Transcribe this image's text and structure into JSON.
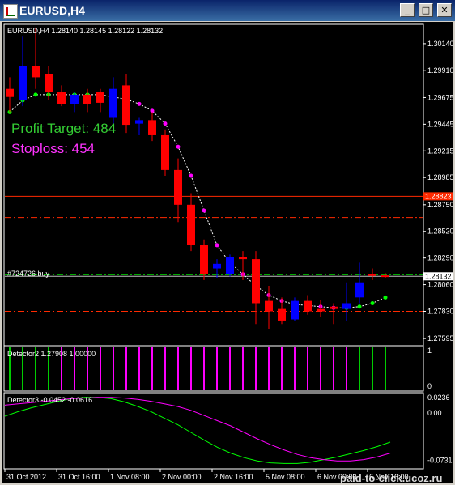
{
  "window": {
    "title": "EURUSD,H4",
    "buttons": {
      "minimize": "_",
      "maximize": "□",
      "close": "✕"
    }
  },
  "chart_data": {
    "type": "candlestick",
    "symbol_line": "EURUSD,H4  1.28140 1.28145 1.28122 1.28132",
    "price_axis": {
      "ylim": [
        1.2754,
        1.303
      ],
      "ticks": [
        "1.30140",
        "1.29910",
        "1.29675",
        "1.29445",
        "1.29215",
        "1.28985",
        "1.28750",
        "1.28520",
        "1.28290",
        "1.28060",
        "1.27830",
        "1.27595"
      ],
      "tick_values": [
        1.3014,
        1.2991,
        1.29675,
        1.29445,
        1.29215,
        1.28985,
        1.2875,
        1.2852,
        1.2829,
        1.2806,
        1.2783,
        1.27595
      ],
      "current_price": "1.28132",
      "marked_price": "1.28823"
    },
    "time_axis": [
      "31 Oct 2012",
      "31 Oct 16:00",
      "1 Nov 08:00",
      "2 Nov 00:00",
      "2 Nov 16:00",
      "5 Nov 08:00",
      "6 Nov 00:00",
      "6 Nov 16:00"
    ],
    "candles": [
      {
        "o": 1.2975,
        "h": 1.2985,
        "l": 1.2955,
        "c": 1.2968,
        "dir": "down"
      },
      {
        "o": 1.2965,
        "h": 1.302,
        "l": 1.296,
        "c": 1.2995,
        "dir": "up"
      },
      {
        "o": 1.2995,
        "h": 1.3028,
        "l": 1.2975,
        "c": 1.2985,
        "dir": "down"
      },
      {
        "o": 1.2988,
        "h": 1.2995,
        "l": 1.2965,
        "c": 1.2972,
        "dir": "down"
      },
      {
        "o": 1.2972,
        "h": 1.2978,
        "l": 1.296,
        "c": 1.2962,
        "dir": "down"
      },
      {
        "o": 1.2962,
        "h": 1.2972,
        "l": 1.2955,
        "c": 1.297,
        "dir": "up"
      },
      {
        "o": 1.297,
        "h": 1.2975,
        "l": 1.2955,
        "c": 1.2962,
        "dir": "down"
      },
      {
        "o": 1.2963,
        "h": 1.2975,
        "l": 1.2955,
        "c": 1.2972,
        "dir": "down"
      },
      {
        "o": 1.295,
        "h": 1.2985,
        "l": 1.294,
        "c": 1.2975,
        "dir": "up"
      },
      {
        "o": 1.2978,
        "h": 1.2988,
        "l": 1.2937,
        "c": 1.2944,
        "dir": "down"
      },
      {
        "o": 1.2945,
        "h": 1.295,
        "l": 1.2935,
        "c": 1.2948,
        "dir": "up"
      },
      {
        "o": 1.2948,
        "h": 1.2955,
        "l": 1.293,
        "c": 1.2935,
        "dir": "down"
      },
      {
        "o": 1.2935,
        "h": 1.294,
        "l": 1.29,
        "c": 1.2905,
        "dir": "down"
      },
      {
        "o": 1.2905,
        "h": 1.2915,
        "l": 1.286,
        "c": 1.2875,
        "dir": "down"
      },
      {
        "o": 1.2875,
        "h": 1.2885,
        "l": 1.2835,
        "c": 1.284,
        "dir": "down"
      },
      {
        "o": 1.284,
        "h": 1.2845,
        "l": 1.281,
        "c": 1.2815,
        "dir": "down"
      },
      {
        "o": 1.282,
        "h": 1.2828,
        "l": 1.2812,
        "c": 1.2824,
        "dir": "up"
      },
      {
        "o": 1.2815,
        "h": 1.2832,
        "l": 1.2813,
        "c": 1.283,
        "dir": "up"
      },
      {
        "o": 1.283,
        "h": 1.2835,
        "l": 1.281,
        "c": 1.2828,
        "dir": "down"
      },
      {
        "o": 1.2828,
        "h": 1.2835,
        "l": 1.2772,
        "c": 1.279,
        "dir": "down"
      },
      {
        "o": 1.2792,
        "h": 1.2805,
        "l": 1.2768,
        "c": 1.2783,
        "dir": "down"
      },
      {
        "o": 1.2785,
        "h": 1.2795,
        "l": 1.2772,
        "c": 1.2775,
        "dir": "down"
      },
      {
        "o": 1.2776,
        "h": 1.2795,
        "l": 1.2775,
        "c": 1.2792,
        "dir": "up"
      },
      {
        "o": 1.2792,
        "h": 1.2797,
        "l": 1.278,
        "c": 1.2783,
        "dir": "down"
      },
      {
        "o": 1.2785,
        "h": 1.2793,
        "l": 1.2778,
        "c": 1.2783,
        "dir": "down"
      },
      {
        "o": 1.2787,
        "h": 1.279,
        "l": 1.2772,
        "c": 1.2785,
        "dir": "down"
      },
      {
        "o": 1.2785,
        "h": 1.2808,
        "l": 1.2775,
        "c": 1.279,
        "dir": "up"
      },
      {
        "o": 1.2795,
        "h": 1.2825,
        "l": 1.279,
        "c": 1.2808,
        "dir": "up"
      },
      {
        "o": 1.2815,
        "h": 1.282,
        "l": 1.281,
        "c": 1.2814,
        "dir": "down"
      },
      {
        "o": 1.2814,
        "h": 1.2816,
        "l": 1.2812,
        "c": 1.2813,
        "dir": "down"
      }
    ],
    "trend_line": [
      1.2955,
      1.2965,
      1.297,
      1.297,
      1.297,
      1.297,
      1.297,
      1.297,
      1.2968,
      1.2966,
      1.2962,
      1.2956,
      1.2945,
      1.2925,
      1.29,
      1.287,
      1.284,
      1.2825,
      1.2815,
      1.2805,
      1.2797,
      1.2792,
      1.2789,
      1.2788,
      1.2787,
      1.2786,
      1.2786,
      1.2787,
      1.279,
      1.2795
    ],
    "horizontal_levels": [
      {
        "price": 1.28823,
        "style": "solid",
        "color": "#ff2a00"
      },
      {
        "price": 1.2864,
        "style": "dashdot",
        "color": "#ff2a00"
      },
      {
        "price": 1.28145,
        "style": "dashdot",
        "color": "#00c000"
      },
      {
        "price": 1.28132,
        "style": "solid",
        "color": "#c0c0c0"
      },
      {
        "price": 1.2783,
        "style": "dashdot",
        "color": "#ff2a00"
      }
    ],
    "order_label": "#724726 buy",
    "profit_target": "Profit Target: 484",
    "stoploss": "Stoploss: 454",
    "detector2": {
      "label": "Detector2  1.27908 1.00000",
      "ticks": [
        "1",
        "0"
      ],
      "bars": [
        "green",
        "green",
        "green",
        "green",
        "magenta",
        "magenta",
        "magenta",
        "magenta",
        "magenta",
        "magenta",
        "magenta",
        "magenta",
        "magenta",
        "magenta",
        "magenta",
        "magenta",
        "magenta",
        "magenta",
        "magenta",
        "magenta",
        "magenta",
        "magenta",
        "magenta",
        "magenta",
        "magenta",
        "magenta",
        "magenta",
        "green",
        "green",
        "green"
      ]
    },
    "detector3": {
      "label": "Detector3  -0.0452 -0.0616",
      "ylim": [
        -0.085,
        0.03
      ],
      "ticks": [
        "0.0236",
        "0.00",
        "-0.0731"
      ],
      "tick_values": [
        0.0236,
        0.0,
        -0.0731
      ],
      "series": [
        {
          "color": "#00ff00",
          "values": [
            -0.005,
            0.002,
            0.008,
            0.013,
            0.018,
            0.022,
            0.024,
            0.024,
            0.022,
            0.017,
            0.01,
            0.002,
            -0.008,
            -0.018,
            -0.03,
            -0.042,
            -0.053,
            -0.062,
            -0.069,
            -0.074,
            -0.077,
            -0.078,
            -0.078,
            -0.076,
            -0.072,
            -0.068,
            -0.063,
            -0.058,
            -0.052,
            -0.045
          ]
        },
        {
          "color": "#ff00ff",
          "values": [
            0.012,
            0.014,
            0.016,
            0.018,
            0.02,
            0.022,
            0.023,
            0.024,
            0.024,
            0.023,
            0.021,
            0.018,
            0.014,
            0.01,
            0.004,
            -0.004,
            -0.012,
            -0.02,
            -0.03,
            -0.04,
            -0.049,
            -0.057,
            -0.064,
            -0.069,
            -0.072,
            -0.074,
            -0.074,
            -0.072,
            -0.068,
            -0.062
          ]
        }
      ]
    },
    "watermark": "paid-to-click.ucoz.ru"
  }
}
